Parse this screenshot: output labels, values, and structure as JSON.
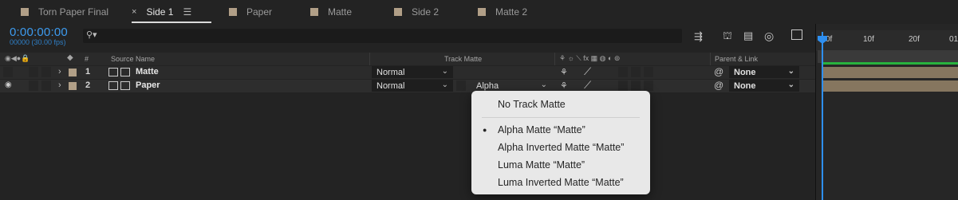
{
  "tabs": [
    {
      "label": "Torn Paper Final"
    },
    {
      "label": "Side 1"
    },
    {
      "label": "Paper"
    },
    {
      "label": "Matte"
    },
    {
      "label": "Side 2"
    },
    {
      "label": "Matte 2"
    }
  ],
  "timecode": {
    "value": "0:00:00:00",
    "fps": "00000 (30.00 fps)"
  },
  "search": {
    "placeholder": ""
  },
  "header": {
    "hash": "#",
    "source_name": "Source Name",
    "track_matte": "Track Matte",
    "parent_link": "Parent & Link"
  },
  "layers": [
    {
      "number": "1",
      "name": "Matte",
      "mode": "Normal",
      "matte": "",
      "parent": "None"
    },
    {
      "number": "2",
      "name": "Paper",
      "mode": "Normal",
      "matte": "Alpha",
      "parent": "None"
    }
  ],
  "ruler": {
    "ticks": [
      "0f",
      "10f",
      "20f",
      "01"
    ]
  },
  "track_matte_menu": {
    "items": [
      {
        "label": "No Track Matte",
        "selected": false
      },
      {
        "label": "Alpha Matte “Matte”",
        "selected": true
      },
      {
        "label": "Alpha Inverted Matte “Matte”",
        "selected": false
      },
      {
        "label": "Luma Matte “Matte”",
        "selected": false
      },
      {
        "label": "Luma Inverted Matte “Matte”",
        "selected": false
      }
    ]
  },
  "colors": {
    "accent": "#2e8ff0",
    "label": "#b19f87",
    "bar": "#86765f"
  }
}
